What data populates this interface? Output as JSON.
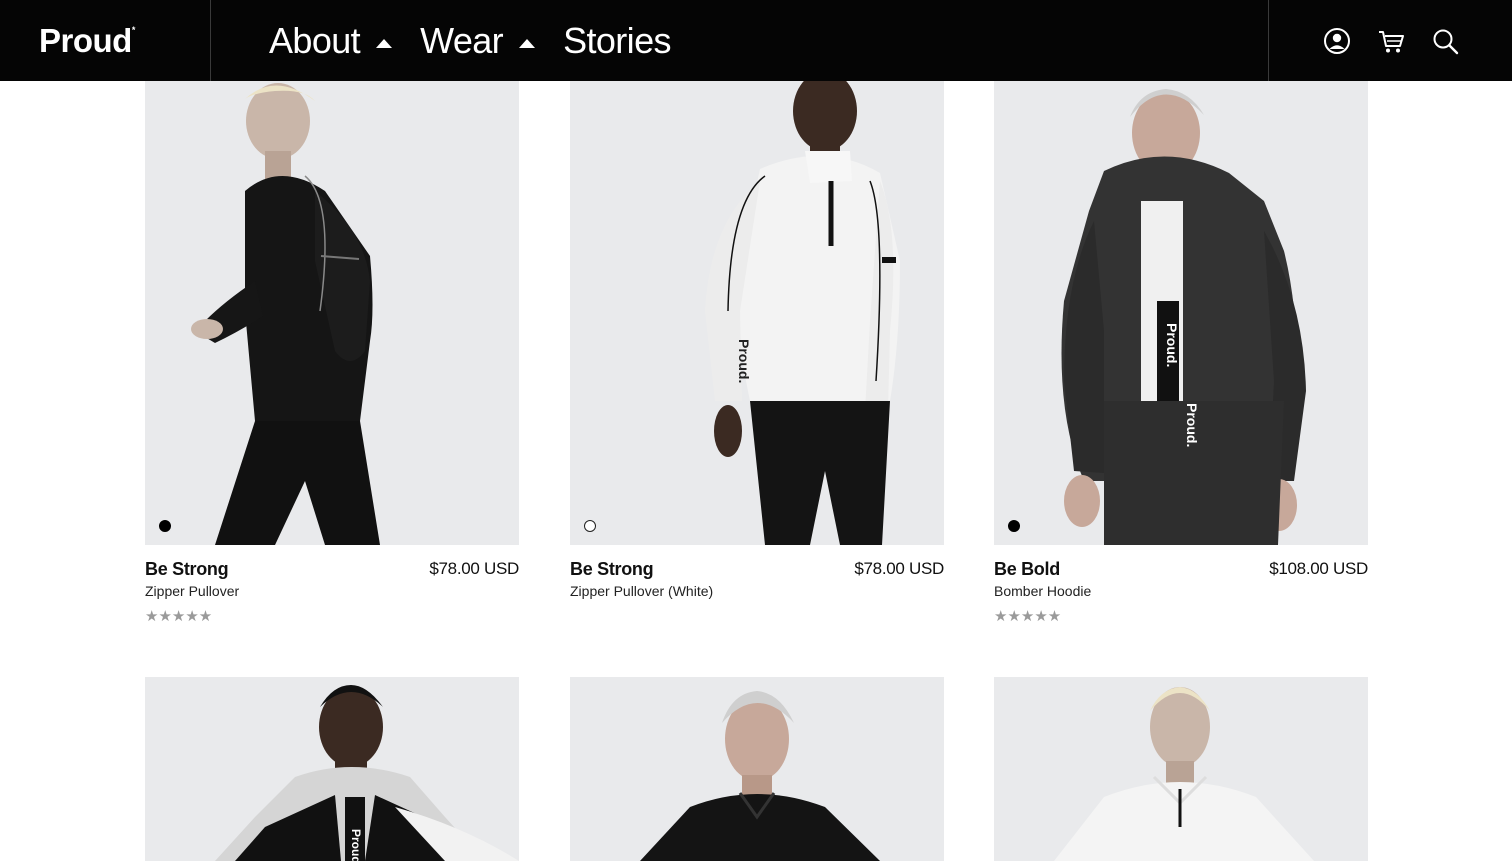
{
  "header": {
    "logo": "Proud",
    "logo_mark": "*",
    "nav": [
      {
        "label": "About",
        "has_dropdown": true
      },
      {
        "label": "Wear",
        "has_dropdown": true
      },
      {
        "label": "Stories",
        "has_dropdown": false
      }
    ],
    "icons": [
      "account-icon",
      "cart-icon",
      "search-icon"
    ]
  },
  "products": [
    {
      "name": "Be Strong",
      "subtitle": "Zipper Pullover",
      "price": "$78.00 USD",
      "swatch": "black",
      "stars": "★★★★★",
      "rating": 0
    },
    {
      "name": "Be Strong",
      "subtitle": "Zipper Pullover (White)",
      "price": "$78.00 USD",
      "swatch": "white",
      "stars": "",
      "rating": null
    },
    {
      "name": "Be Bold",
      "subtitle": "Bomber Hoodie",
      "price": "$108.00 USD",
      "swatch": "black",
      "stars": "★★★★★",
      "rating": 0
    }
  ],
  "photo_text": {
    "sleeve_print": "Proud.",
    "zipper_print_1": "Proud.",
    "zipper_print_2": "Proud.",
    "hoodie_print": "Proud"
  },
  "colors": {
    "header_bg": "#050505",
    "photo_bg": "#e9eaec",
    "star_gray": "#9a9a9a"
  }
}
